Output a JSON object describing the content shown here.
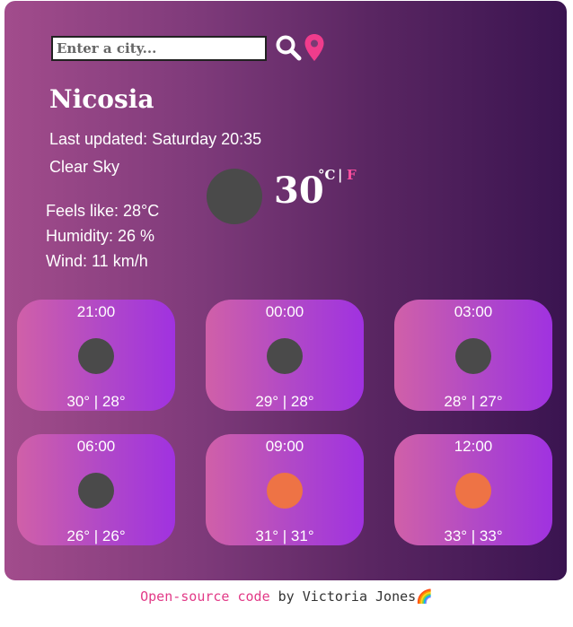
{
  "search": {
    "placeholder": "Enter a city..."
  },
  "current": {
    "city": "Nicosia",
    "last_updated": "Last updated: Saturday 20:35",
    "description": "Clear Sky",
    "temperature": "30",
    "unit_c": "°C",
    "unit_sep": "|",
    "unit_f": "F",
    "feels_like": "Feels like: 28°C",
    "humidity": "Humidity: 26 %",
    "wind": "Wind: 11 km/h",
    "icon_color": "#4a4a4a"
  },
  "forecast": [
    {
      "time": "21:00",
      "temps": "30° | 28°",
      "icon_color": "#4a4a4a"
    },
    {
      "time": "00:00",
      "temps": "29° | 28°",
      "icon_color": "#4a4a4a"
    },
    {
      "time": "03:00",
      "temps": "28° | 27°",
      "icon_color": "#4a4a4a"
    },
    {
      "time": "06:00",
      "temps": "26° | 26°",
      "icon_color": "#4a4a4a"
    },
    {
      "time": "09:00",
      "temps": "31° | 31°",
      "icon_color": "#ee7345"
    },
    {
      "time": "12:00",
      "temps": "33° | 33°",
      "icon_color": "#ee7345"
    }
  ],
  "footer": {
    "link_text": "Open-source code",
    "by_text": " by Victoria Jones",
    "emoji": "🌈"
  }
}
